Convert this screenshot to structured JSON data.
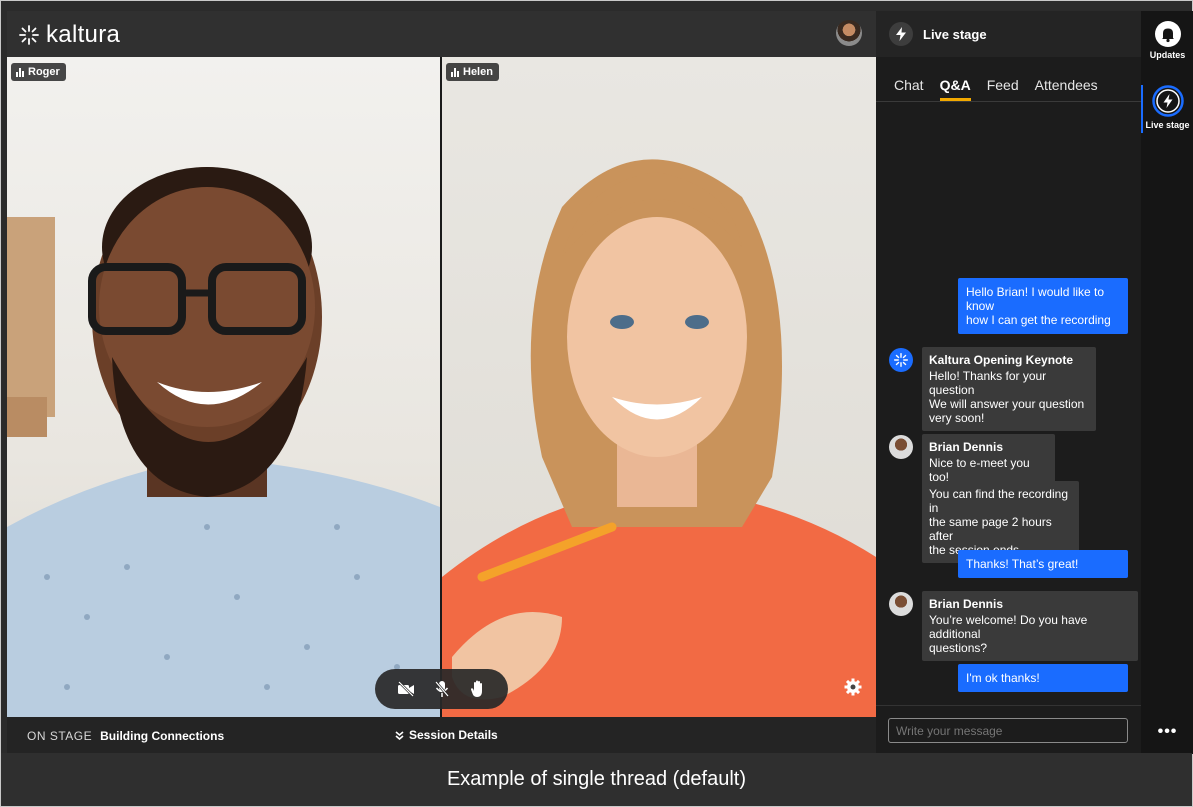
{
  "app": {
    "brand": "kaltura"
  },
  "participants": [
    {
      "name": "Roger"
    },
    {
      "name": "Helen"
    }
  ],
  "bottom_bar": {
    "on_stage_label": "ON STAGE",
    "stage_title": "Building Connections",
    "session_details": "Session Details"
  },
  "panel": {
    "title": "Live stage",
    "tabs": [
      {
        "label": "Chat",
        "active": false
      },
      {
        "label": "Q&A",
        "active": true
      },
      {
        "label": "Feed",
        "active": false
      },
      {
        "label": "Attendees",
        "active": false
      }
    ],
    "messages": {
      "m1_lines": [
        "Hello Brian! I would like to",
        "know",
        "how I can get the recording"
      ],
      "m2_sender": "Kaltura Opening Keynote",
      "m2_lines": [
        "Hello! Thanks for your question",
        "We will answer your question",
        "very soon!"
      ],
      "m3_sender": "Brian Dennis",
      "m3_text": "Nice to e-meet you too!",
      "m4_lines": [
        "You can find the recording in",
        "the same page 2 hours after",
        "the session ends"
      ],
      "m5_text": "Thanks! That’s great!",
      "m6_sender": "Brian Dennis",
      "m6_lines": [
        "You’re welcome! Do you have additional",
        "questions?"
      ],
      "m7_text": "I'm ok thanks!"
    },
    "composer_placeholder": "Write your message"
  },
  "rail": {
    "updates_label": "Updates",
    "live_stage_label": "Live stage",
    "more_label": "•••"
  },
  "caption": "Example of single thread (default)",
  "colors": {
    "accent_blue": "#1a6cff",
    "tab_underline": "#f2a900",
    "panel_bg": "#1c1c1c"
  }
}
